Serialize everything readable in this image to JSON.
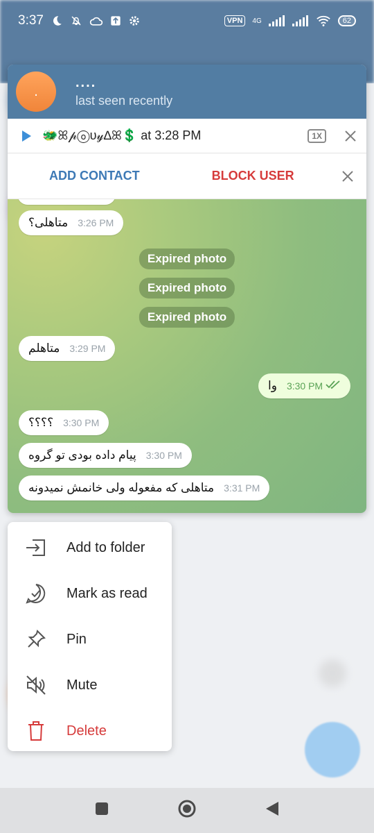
{
  "status_bar": {
    "time": "3:37",
    "vpn": "VPN",
    "network": "4G",
    "battery": "62"
  },
  "preview": {
    "name": "....",
    "avatar_text": ".",
    "status": "last seen recently",
    "playing": {
      "text": "🐲ꕤ𝓅ⓞυ𝓎∆ꕤ💲 at 3:28 PM",
      "speed": "1X"
    },
    "actions": {
      "add_contact": "ADD CONTACT",
      "block_user": "BLOCK USER"
    },
    "messages": [
      {
        "text": "متاهلی؟",
        "time": "3:26 PM",
        "out": false
      },
      {
        "service": "Expired photo"
      },
      {
        "service": "Expired photo"
      },
      {
        "service": "Expired photo"
      },
      {
        "text": "متاهلم",
        "time": "3:29 PM",
        "out": false
      },
      {
        "text": "وا",
        "time": "3:30 PM",
        "out": true
      },
      {
        "text": "؟؟؟؟",
        "time": "3:30 PM",
        "out": false
      },
      {
        "text": "پیام داده بودی تو گروه",
        "time": "3:30 PM",
        "out": false
      },
      {
        "text": "متاهلی که مفعوله ولی خانمش نمیدونه",
        "time": "3:31 PM",
        "out": false
      }
    ]
  },
  "menu": {
    "items": [
      {
        "label": "Add to folder",
        "icon": "folder-add-icon"
      },
      {
        "label": "Mark as read",
        "icon": "check-circle-icon"
      },
      {
        "label": "Pin",
        "icon": "pin-icon"
      },
      {
        "label": "Mute",
        "icon": "mute-icon"
      },
      {
        "label": "Delete",
        "icon": "trash-icon"
      }
    ]
  },
  "colors": {
    "header": "#527da3",
    "accent_blue": "#3d79b5",
    "danger": "#d63b3b",
    "outgoing_time": "#5aa356"
  }
}
